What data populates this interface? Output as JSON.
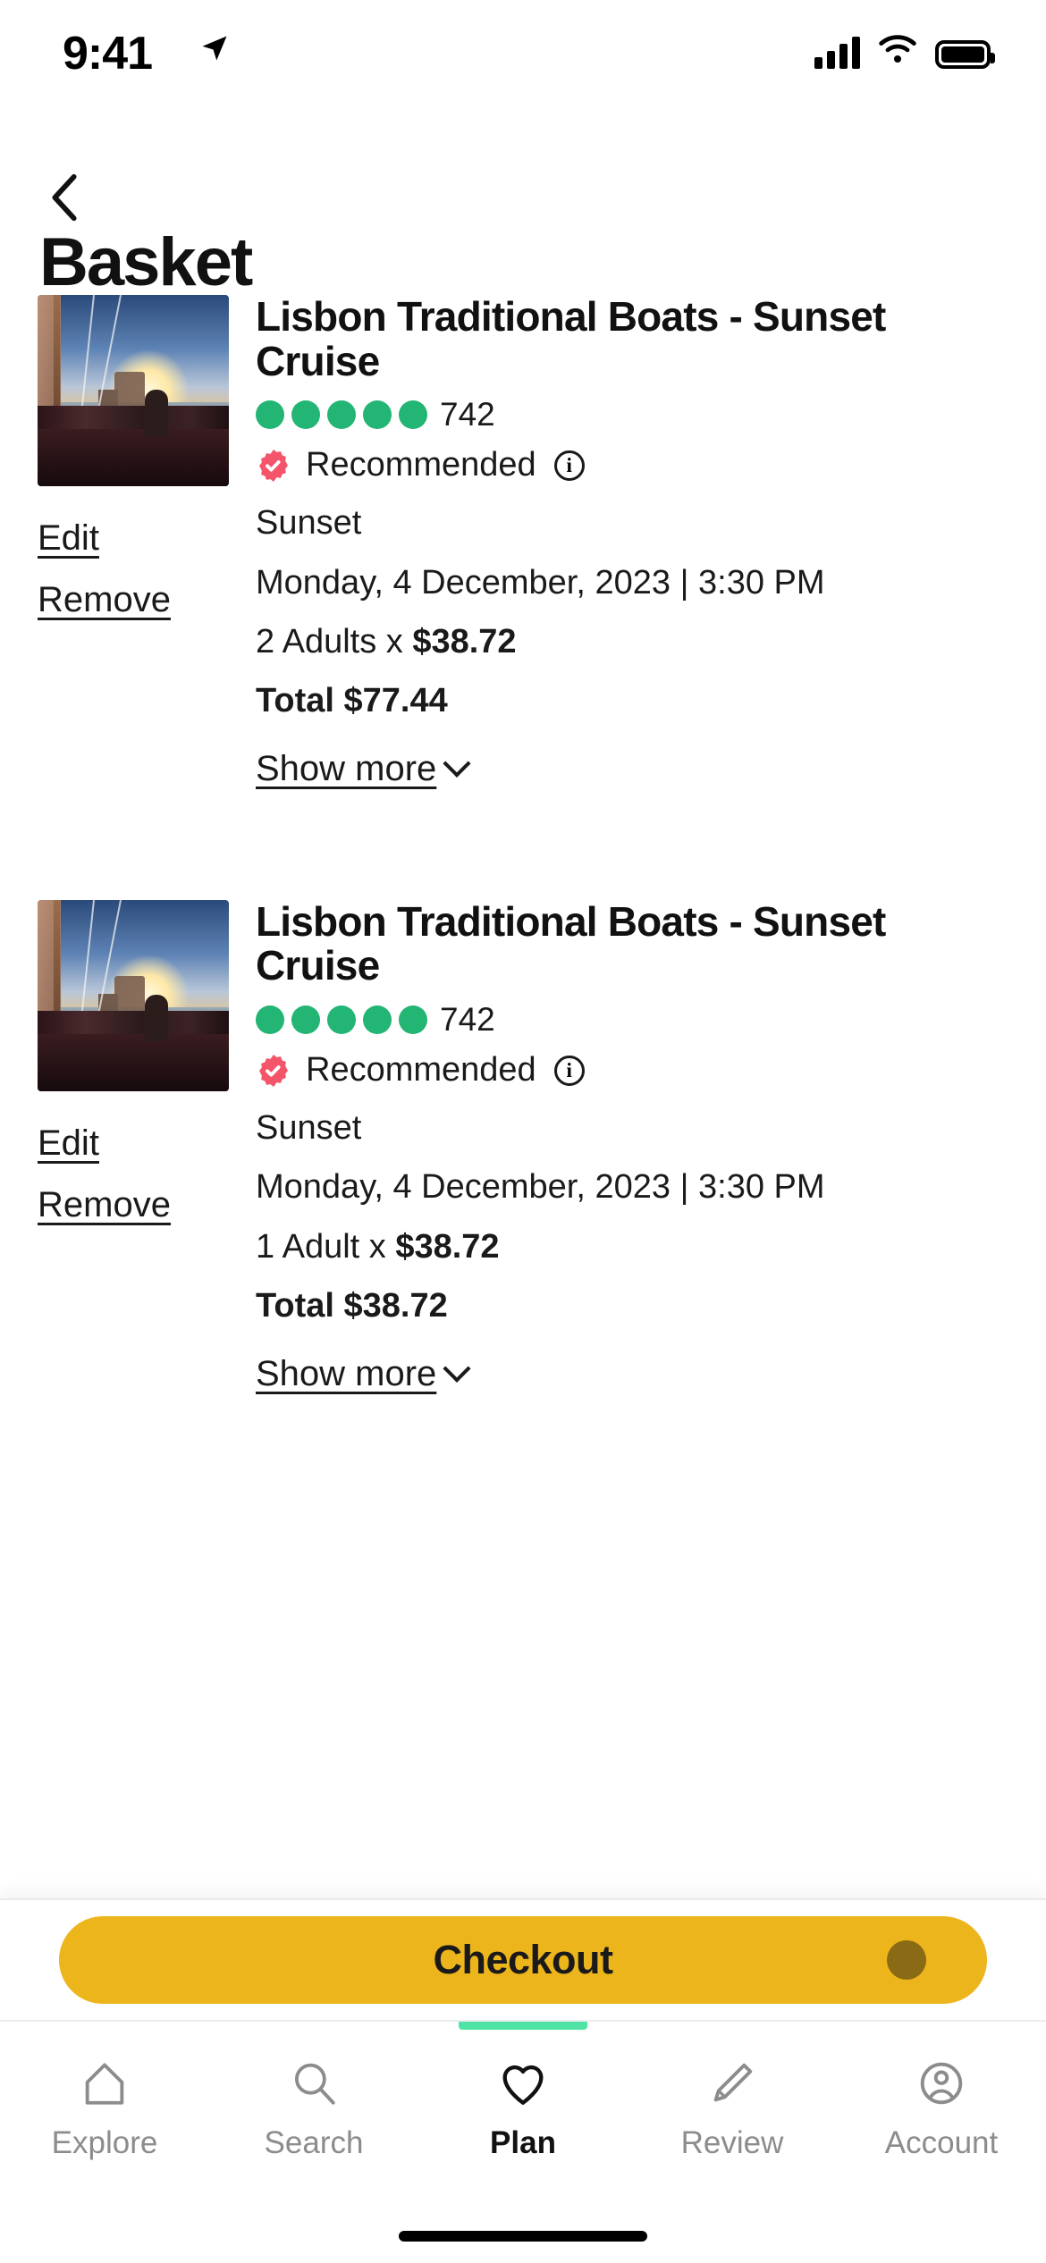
{
  "status_bar": {
    "time": "9:41",
    "location_icon": "location-arrow-icon",
    "signal_icon": "cellular-signal-icon",
    "wifi_icon": "wifi-icon",
    "battery_icon": "battery-full-icon"
  },
  "header": {
    "back_icon": "chevron-left-icon",
    "title": "Basket"
  },
  "basket_items": [
    {
      "title": "Lisbon Traditional Boats - Sunset Cruise",
      "rating_dots": 5,
      "rating_count": "742",
      "recommended_badge_icon": "verified-check-badge-icon",
      "recommended_label": "Recommended",
      "info_icon": "info-circle-icon",
      "option": "Sunset",
      "datetime": "Monday, 4 December, 2023 | 3:30 PM",
      "quantity_label": "2 Adults x ",
      "unit_price": "$38.72",
      "total": "Total $77.44",
      "show_more": "Show more",
      "show_more_icon": "chevron-down-icon",
      "edit_label": "Edit",
      "remove_label": "Remove"
    },
    {
      "title": "Lisbon Traditional Boats - Sunset Cruise",
      "rating_dots": 5,
      "rating_count": "742",
      "recommended_badge_icon": "verified-check-badge-icon",
      "recommended_label": "Recommended",
      "info_icon": "info-circle-icon",
      "option": "Sunset",
      "datetime": "Monday, 4 December, 2023 | 3:30 PM",
      "quantity_label": "1 Adult x ",
      "unit_price": "$38.72",
      "total": "Total $38.72",
      "show_more": "Show more",
      "show_more_icon": "chevron-down-icon",
      "edit_label": "Edit",
      "remove_label": "Remove"
    }
  ],
  "checkout": {
    "label": "Checkout",
    "button_color": "#EDB51C",
    "dot_color": "#8A6A14"
  },
  "tabbar": {
    "active_indicator_color": "#4FE3A5",
    "items": [
      {
        "label": "Explore",
        "icon": "home-icon",
        "active": false
      },
      {
        "label": "Search",
        "icon": "search-icon",
        "active": false
      },
      {
        "label": "Plan",
        "icon": "heart-icon",
        "active": true
      },
      {
        "label": "Review",
        "icon": "pencil-icon",
        "active": false
      },
      {
        "label": "Account",
        "icon": "user-circle-icon",
        "active": false
      }
    ]
  },
  "colors": {
    "rating_green": "#22B573",
    "badge_pink": "#F4556A",
    "accent_yellow": "#EDB51C",
    "tab_active_green": "#4FE3A5"
  }
}
